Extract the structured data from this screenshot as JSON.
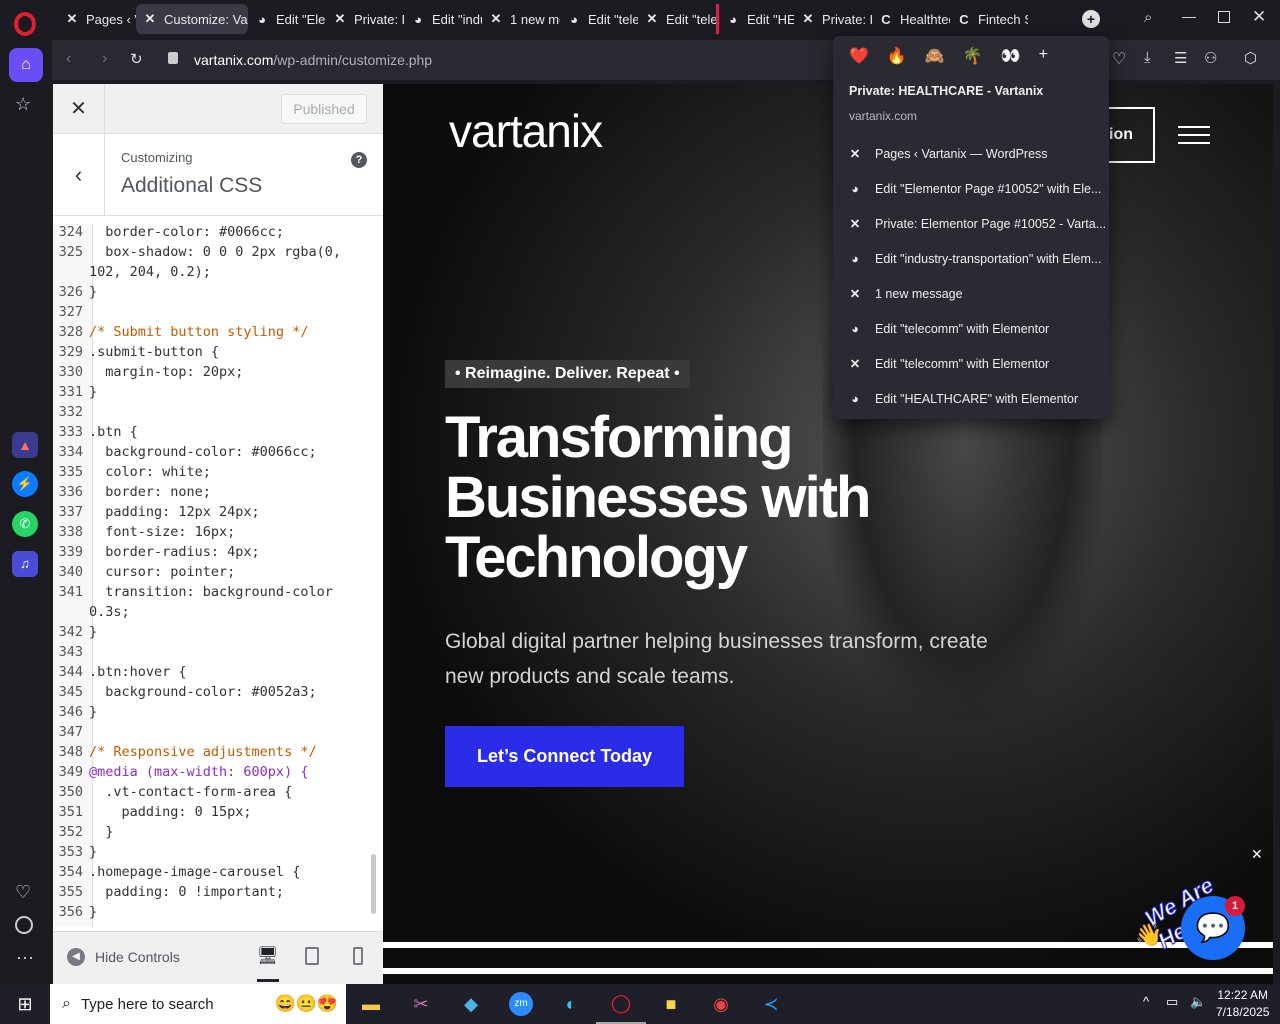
{
  "browser": {
    "tabs": [
      {
        "label": "Pages ‹ V",
        "icon": "x-logo-icon"
      },
      {
        "label": "Customize: Varta",
        "icon": "x-logo-icon"
      },
      {
        "label": "Edit \"Elem",
        "icon": "globe-icon"
      },
      {
        "label": "Private: E",
        "icon": "x-logo-icon"
      },
      {
        "label": "Edit \"indu",
        "icon": "globe-icon"
      },
      {
        "label": "1 new me",
        "icon": "x-logo-icon"
      },
      {
        "label": "Edit \"tele",
        "icon": "globe-icon"
      },
      {
        "label": "Edit \"tele",
        "icon": "x-logo-icon"
      },
      {
        "label": "Edit \"HEA",
        "icon": "globe-icon"
      },
      {
        "label": "Private: H",
        "icon": "x-logo-icon"
      },
      {
        "label": "Healthtec",
        "icon": "c-logo-icon"
      },
      {
        "label": "Fintech S",
        "icon": "c-logo-icon"
      }
    ],
    "url_domain": "vartanix.com",
    "url_path": "/wp-admin/customize.php"
  },
  "dropdown": {
    "emojis": [
      "❤️",
      "🔥",
      "🙈",
      "🌴",
      "👀",
      "+"
    ],
    "title": "Private: HEALTHCARE - Vartanix",
    "domain": "vartanix.com",
    "items": [
      {
        "label": "Pages ‹ Vartanix — WordPress",
        "icon": "x-logo-icon"
      },
      {
        "label": "Edit \"Elementor Page #10052\" with Ele...",
        "icon": "globe-icon"
      },
      {
        "label": "Private: Elementor Page #10052 - Varta...",
        "icon": "x-logo-icon"
      },
      {
        "label": "Edit \"industry-transportation\" with Elem...",
        "icon": "globe-icon"
      },
      {
        "label": "1 new message",
        "icon": "x-logo-icon"
      },
      {
        "label": "Edit \"telecomm\" with Elementor",
        "icon": "globe-icon"
      },
      {
        "label": "Edit \"telecomm\" with Elementor",
        "icon": "x-logo-icon"
      },
      {
        "label": "Edit \"HEALTHCARE\" with Elementor",
        "icon": "globe-icon"
      }
    ]
  },
  "customizer": {
    "published_label": "Published",
    "customizing_label": "Customizing",
    "section_title": "Additional CSS",
    "hide_controls": "Hide Controls",
    "code_lines": [
      {
        "n": "324",
        "t": "  border-color: #0066cc;"
      },
      {
        "n": "325",
        "t": "  box-shadow: 0 0 0 2px rgba(0,"
      },
      {
        "n": "",
        "t": "102, 204, 0.2);"
      },
      {
        "n": "326",
        "t": "}"
      },
      {
        "n": "327",
        "t": ""
      },
      {
        "n": "328",
        "t": "/* Submit button styling */"
      },
      {
        "n": "329",
        "t": ".submit-button {"
      },
      {
        "n": "330",
        "t": "  margin-top: 20px;"
      },
      {
        "n": "331",
        "t": "}"
      },
      {
        "n": "332",
        "t": ""
      },
      {
        "n": "333",
        "t": ".btn {"
      },
      {
        "n": "334",
        "t": "  background-color: #0066cc;"
      },
      {
        "n": "335",
        "t": "  color: white;"
      },
      {
        "n": "336",
        "t": "  border: none;"
      },
      {
        "n": "337",
        "t": "  padding: 12px 24px;"
      },
      {
        "n": "338",
        "t": "  font-size: 16px;"
      },
      {
        "n": "339",
        "t": "  border-radius: 4px;"
      },
      {
        "n": "340",
        "t": "  cursor: pointer;"
      },
      {
        "n": "341",
        "t": "  transition: background-color"
      },
      {
        "n": "",
        "t": "0.3s;"
      },
      {
        "n": "342",
        "t": "}"
      },
      {
        "n": "343",
        "t": ""
      },
      {
        "n": "344",
        "t": ".btn:hover {"
      },
      {
        "n": "345",
        "t": "  background-color: #0052a3;"
      },
      {
        "n": "346",
        "t": "}"
      },
      {
        "n": "347",
        "t": ""
      },
      {
        "n": "348",
        "t": "/* Responsive adjustments */"
      },
      {
        "n": "349",
        "t": "@media (max-width: 600px) {"
      },
      {
        "n": "350",
        "t": "  .vt-contact-form-area {"
      },
      {
        "n": "351",
        "t": "    padding: 0 15px;"
      },
      {
        "n": "352",
        "t": "  }"
      },
      {
        "n": "353",
        "t": "}"
      },
      {
        "n": "354",
        "t": ".homepage-image-carousel {"
      },
      {
        "n": "355",
        "t": "  padding: 0 !important;"
      },
      {
        "n": "356",
        "t": "}"
      }
    ]
  },
  "preview": {
    "logo": "vartanix",
    "nav_button_fragment": "ion",
    "tagline": "• Reimagine. Deliver. Repeat •",
    "headline_1": "Transforming",
    "headline_2": "Businesses with",
    "headline_3": "Technology",
    "subtext_1": "Global digital partner helping businesses transform, create",
    "subtext_2": "new products and scale teams.",
    "cta": "Let’s Connect Today",
    "chat_badge": "We Are Here!",
    "chat_count": "1",
    "accent": "#2a2ce8"
  },
  "taskbar": {
    "search_placeholder": "Type here to search",
    "time": "12:22 AM",
    "date": "7/18/2025"
  }
}
